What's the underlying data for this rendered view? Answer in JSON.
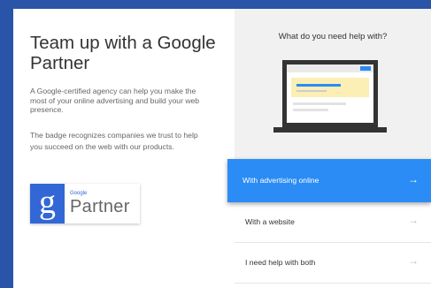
{
  "left": {
    "headline": "Team up with a Google Partner",
    "paragraph1": "A Google-certified agency can help you make the most of your online advertising and build your web presence.",
    "paragraph2": "The badge recognizes companies we trust to help you succeed on the web with our products.",
    "badge": {
      "google": "Google",
      "partner": "Partner",
      "letter": "g"
    }
  },
  "panel": {
    "title": "What do you need help with?",
    "options": [
      {
        "label": "With advertising online",
        "arrow": "→",
        "active": true
      },
      {
        "label": "With a website",
        "arrow": "→",
        "active": false
      },
      {
        "label": "I need help with both",
        "arrow": "→",
        "active": false
      }
    ]
  },
  "colors": {
    "background": "#2a54a8",
    "active": "#2a8cf4",
    "badge_blue": "#3367d6"
  }
}
